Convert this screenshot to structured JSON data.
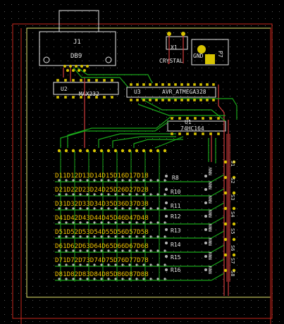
{
  "colors": {
    "background": "#000000",
    "grid": "#5a5a5a",
    "outline_red": "#c8281e",
    "outline_yellow": "#e6e66e",
    "silk": "#e8e8e8",
    "pad_yellow": "#d7c300",
    "track_green": "#1aa61a",
    "track_red": "#d23c3c",
    "pad_gray": "#b4b4b4"
  },
  "components": {
    "j1": {
      "ref": "J1",
      "value": "DB9"
    },
    "x1": {
      "ref": "X1",
      "value": "CRYSTAL"
    },
    "p7": {
      "ref": "P7",
      "gnd": "GND"
    },
    "u2": {
      "ref": "U2",
      "value": "MAX232"
    },
    "u3": {
      "ref": "U3",
      "value": "AVR_ATMEGA328"
    },
    "u1": {
      "ref": "U1",
      "value": "74HC164"
    }
  },
  "resistor_row_labels": [
    "R8",
    "R10",
    "R11",
    "R12",
    "R13",
    "R14",
    "R15",
    "R16"
  ],
  "led_matrix": {
    "rows": [
      "D11D12D13D14D15D16D17D18",
      "D21D22D23D24D25D26D27D28",
      "D31D32D33D34D35D36D37D38",
      "D41D42D43D44D45D46D47D48",
      "D51D52D53D54D55D56D57D58",
      "D61D62D63D64D65D66D67D68",
      "D71D72D73D74D75D76D77D78",
      "D81D82D83D84D85D86D87D88"
    ]
  },
  "side_labels": [
    "S1",
    "S2",
    "S3",
    "S4",
    "S5",
    "S6",
    "S7",
    "S8"
  ],
  "nnn_label": "NNN"
}
